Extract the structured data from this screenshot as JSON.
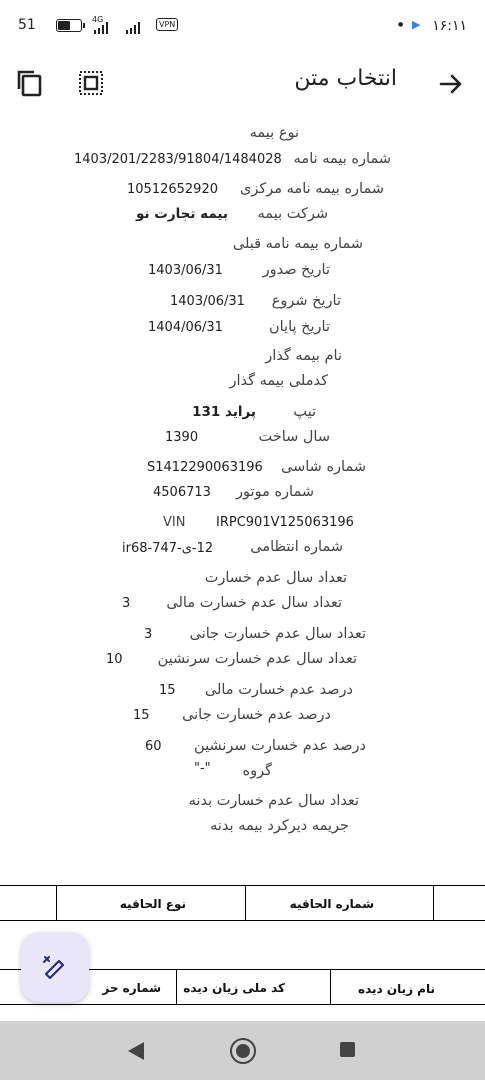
{
  "status_bar": {
    "time": "۱۶:۱۱",
    "battery": "51",
    "network": "4G",
    "vpn": "VPN"
  },
  "app_bar": {
    "title": "انتخاب متن"
  },
  "fields": {
    "insurance_type": {
      "label": "نوع بیمه"
    },
    "policy_number": {
      "label": "شماره بیمه نامه",
      "value": "1403/201/2283/91804/1484028"
    },
    "central_policy_number": {
      "label": "شماره بیمه نامه مرکزی",
      "value": "10512652920"
    },
    "insurer": {
      "label": "شرکت بیمه",
      "value": "بیمه تجارت نو"
    },
    "previous_policy": {
      "label": "شماره بیمه نامه قبلی"
    },
    "issue_date": {
      "label": "تاریخ صدور",
      "value": "1403/06/31"
    },
    "start_date": {
      "label": "تاریخ شروع",
      "value": "1403/06/31"
    },
    "end_date": {
      "label": "تاریخ پایان",
      "value": "1404/06/31"
    },
    "policyholder_name": {
      "label": "نام بیمه گذار"
    },
    "policyholder_national_code": {
      "label": "کدملی بیمه گذار"
    },
    "vehicle_type": {
      "label": "تیپ",
      "value": "پراید 131"
    },
    "manufacture_year": {
      "label": "سال ساخت",
      "value": "1390"
    },
    "chassis_number": {
      "label": "شماره شاسی",
      "value": "S1412290063196"
    },
    "engine_number": {
      "label": "شماره موتور",
      "value": "4506713"
    },
    "vin": {
      "label": "VIN",
      "value": "IRPC901V125063196"
    },
    "plate_number": {
      "label": "شماره انتظامی",
      "value": "12-ی-747-ir68"
    },
    "no_claim_years": {
      "label": "تعداد سال عدم خسارت"
    },
    "no_claim_years_financial": {
      "label": "تعداد سال عدم خسارت مالی",
      "value": "3"
    },
    "no_claim_years_bodily": {
      "label": "تعداد سال عدم خسارت جانی",
      "value": "3"
    },
    "no_claim_years_passenger": {
      "label": "تعداد سال عدم خسارت سرنشین",
      "value": "10"
    },
    "no_claim_percent_financial": {
      "label": "درصد عدم خسارت مالی",
      "value": "15"
    },
    "no_claim_percent_bodily": {
      "label": "درصد عدم خسارت جانی",
      "value": "15"
    },
    "no_claim_percent_passenger": {
      "label": "درصد عدم خسارت سرنشین",
      "value": "60"
    },
    "group": {
      "label": "گروه",
      "value": "\"-\""
    },
    "no_claim_years_body": {
      "label": "تعداد سال عدم خسارت بدنه"
    },
    "body_late_penalty": {
      "label": "جریمه دیرکرد بیمه بدنه"
    }
  },
  "table1": {
    "header_endorsement_number": "شماره الحاقیه",
    "header_endorsement_type": "نوع الحاقیه"
  },
  "table2": {
    "header_victim_name": "نام زیان دیده",
    "header_victim_national_code": "کد ملی زیان دیده",
    "header_number_partial": "شماره حز"
  },
  "icons": {
    "back": "arrow-right-icon",
    "copy": "copy-icon",
    "select_all": "select-all-icon",
    "fab": "edit-pen-icon"
  },
  "colors": {
    "fab_background": "#e9e6fa",
    "nav_bar": "#d0d0d0"
  }
}
